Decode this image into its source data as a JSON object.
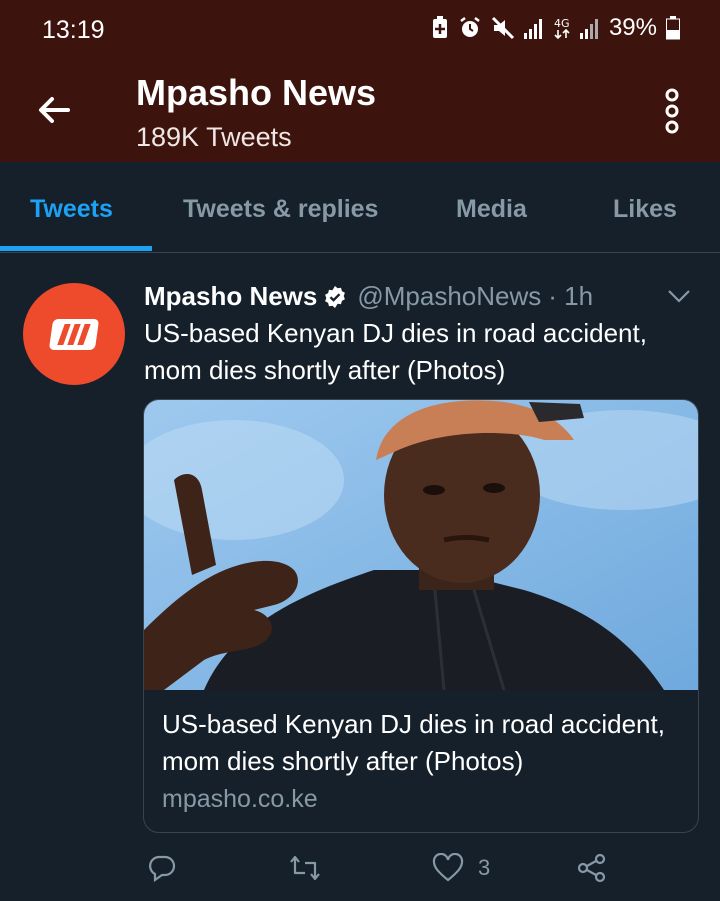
{
  "status_bar": {
    "time": "13:19",
    "battery": "39%",
    "icons": [
      "battery-saver-icon",
      "alarm-icon",
      "mute-icon",
      "signal-icon",
      "4g-icon",
      "signal-icon-2",
      "battery-icon"
    ]
  },
  "header": {
    "title": "Mpasho News",
    "subtitle": "189K Tweets",
    "background": "#3d140d"
  },
  "tabs": [
    {
      "label": "Tweets",
      "active": true
    },
    {
      "label": "Tweets & replies",
      "active": false
    },
    {
      "label": "Media",
      "active": false
    },
    {
      "label": "Likes",
      "active": false
    }
  ],
  "tweet": {
    "name": "Mpasho News",
    "handle": "@MpashoNews",
    "time": "· 1h",
    "text": "US-based Kenyan DJ dies in road accident, mom dies shortly after (Photos)",
    "card": {
      "title": "US-based Kenyan DJ dies in road accident, mom dies shortly after (Photos)",
      "domain": "mpasho.co.ke"
    },
    "like_count": "3"
  },
  "colors": {
    "accent": "#1da1f2",
    "background": "#15202b",
    "secondary_text": "#8899a6",
    "avatar": "#ee4a2c"
  }
}
